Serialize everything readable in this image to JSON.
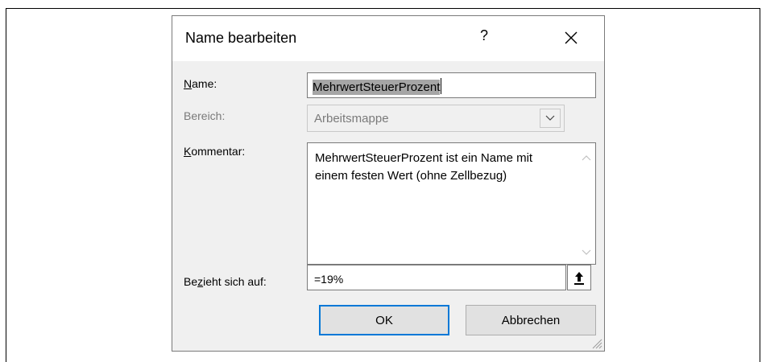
{
  "dialog": {
    "title": "Name bearbeiten",
    "help_glyph": "?",
    "close_glyph": "✕"
  },
  "fields": {
    "name": {
      "label_mnemonic": "N",
      "label_rest": "ame:",
      "value": "MehrwertSteuerProzent"
    },
    "scope": {
      "label": "Bereich:",
      "value": "Arbeitsmappe"
    },
    "comment": {
      "label_mnemonic": "K",
      "label_rest": "ommentar:",
      "value": "MehrwertSteuerProzent ist ein Name mit einem festen Wert (ohne Zellbezug)"
    },
    "refers_to": {
      "label_pre": "Be",
      "label_mnemonic": "z",
      "label_post": "ieht sich auf:",
      "value": "=19%"
    }
  },
  "buttons": {
    "ok_label": "OK",
    "cancel_label": "Abbrechen"
  },
  "icons": {
    "close": "close-icon",
    "dropdown": "chevron-down-icon",
    "scroll_up": "chevron-up-icon",
    "scroll_down": "chevron-down-icon",
    "collapse_dialog": "collapse-dialog-icon",
    "resize_grip": "resize-grip-icon"
  },
  "colors": {
    "dialog_bg": "#f0f0f0",
    "titlebar_bg": "#ffffff",
    "default_button_border": "#0078d7",
    "selection_highlight": "#a6a6a6",
    "disabled_text": "#7a7a7a"
  }
}
